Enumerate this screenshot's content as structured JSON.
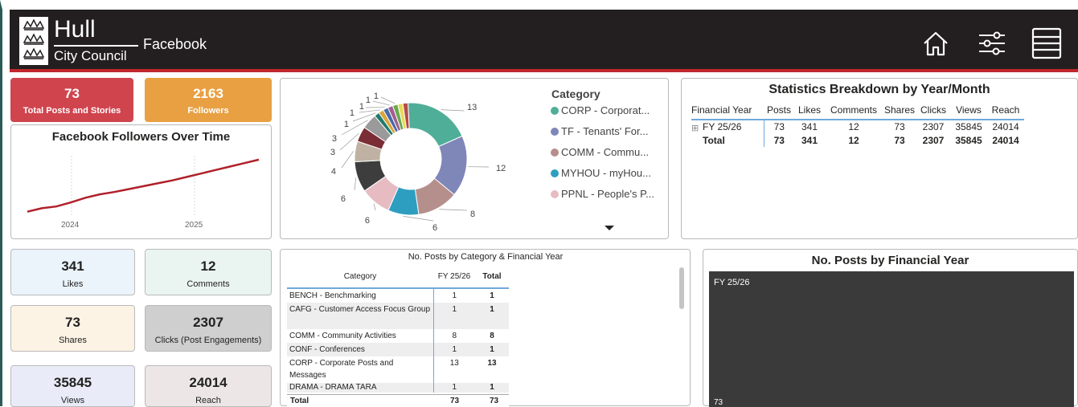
{
  "header": {
    "logo_line1": "Hull",
    "logo_line2": "City Council",
    "page_title": "Facebook",
    "icons": [
      "home-icon",
      "filter-sliders-icon",
      "menu-icon"
    ]
  },
  "colors": {
    "header_bg": "#231f20",
    "accent_red": "#c0272d",
    "kpi_red": "#d0444e",
    "kpi_orange": "#e8a043",
    "trend_line": "#b0212a"
  },
  "kpis_top": [
    {
      "value": "73",
      "label": "Total Posts and Stories"
    },
    {
      "value": "2163",
      "label": "Followers"
    }
  ],
  "kpis_bottom": [
    {
      "value": "341",
      "label": "Likes"
    },
    {
      "value": "12",
      "label": "Comments"
    },
    {
      "value": "73",
      "label": "Shares"
    },
    {
      "value": "2307",
      "label": "Clicks (Post Engagements)"
    },
    {
      "value": "35845",
      "label": "Views"
    },
    {
      "value": "24014",
      "label": "Reach"
    }
  ],
  "followers_chart": {
    "title": "Facebook Followers Over Time",
    "x_labels": [
      "2024",
      "2025"
    ]
  },
  "donut": {
    "legend_title": "Category",
    "legend": [
      {
        "label": "CORP - Corporat...",
        "color": "#4fae98"
      },
      {
        "label": "TF - Tenants' For...",
        "color": "#7f86b8"
      },
      {
        "label": "COMM - Commu...",
        "color": "#b58f8c"
      },
      {
        "label": "MYHOU - myHou...",
        "color": "#2e9ec0"
      },
      {
        "label": "PPNL - People's P...",
        "color": "#e6bcc2"
      }
    ]
  },
  "stats": {
    "title": "Statistics Breakdown by Year/Month",
    "columns": [
      "Financial Year",
      "Posts",
      "Likes",
      "Comments",
      "Shares",
      "Clicks",
      "Views",
      "Reach"
    ],
    "rows": [
      [
        "FY 25/26",
        "73",
        "341",
        "12",
        "73",
        "2307",
        "35845",
        "24014"
      ],
      [
        "Total",
        "73",
        "341",
        "12",
        "73",
        "2307",
        "35845",
        "24014"
      ]
    ]
  },
  "category_table": {
    "title": "No. Posts by Category & Financial Year",
    "columns": [
      "Category",
      "FY 25/26",
      "Total"
    ],
    "rows": [
      [
        "BENCH - Benchmarking",
        "1",
        "1"
      ],
      [
        "CAFG - Customer Access Focus Group",
        "1",
        "1"
      ],
      [
        "COMM - Community Activities",
        "8",
        "8"
      ],
      [
        "CONF - Conferences",
        "1",
        "1"
      ],
      [
        "CORP - Corporate Posts and Messages",
        "13",
        "13"
      ],
      [
        "DRAMA - DRAMA TARA",
        "1",
        "1"
      ]
    ],
    "total": [
      "Total",
      "73",
      "73"
    ]
  },
  "fy_chart": {
    "title": "No. Posts by Financial Year",
    "series_label": "FY 25/26",
    "value_label": "73"
  },
  "chart_data": [
    {
      "type": "pie",
      "variant": "donut",
      "legend_title": "Category",
      "labels": [
        "CORP",
        "TF",
        "COMM",
        "MYHOU",
        "PPNL",
        "other",
        "other",
        "other",
        "other",
        "other",
        "other",
        "other",
        "other",
        "other",
        "other",
        "other"
      ],
      "values": [
        13,
        12,
        8,
        6,
        6,
        6,
        4,
        3,
        3,
        1,
        1,
        1,
        1,
        1,
        1,
        1
      ],
      "data_labels": [
        "13",
        "12",
        "8",
        "6",
        "6",
        "6",
        "4",
        "3",
        "3",
        "1",
        "1",
        "1",
        "1",
        "1"
      ]
    },
    {
      "type": "line",
      "title": "Facebook Followers Over Time",
      "x_tick_labels": [
        "2024",
        "2025"
      ],
      "y_axis_visible": false,
      "series": [
        {
          "values": [
            0.06,
            0.12,
            0.15,
            0.22,
            0.3,
            0.36,
            0.4,
            0.45,
            0.5,
            0.55,
            0.6,
            0.66,
            0.72,
            0.78,
            0.84,
            0.9,
            0.96
          ]
        }
      ]
    },
    {
      "type": "bar",
      "title": "No. Posts by Financial Year",
      "categories": [
        "FY 25/26"
      ],
      "values": [
        73
      ]
    }
  ]
}
